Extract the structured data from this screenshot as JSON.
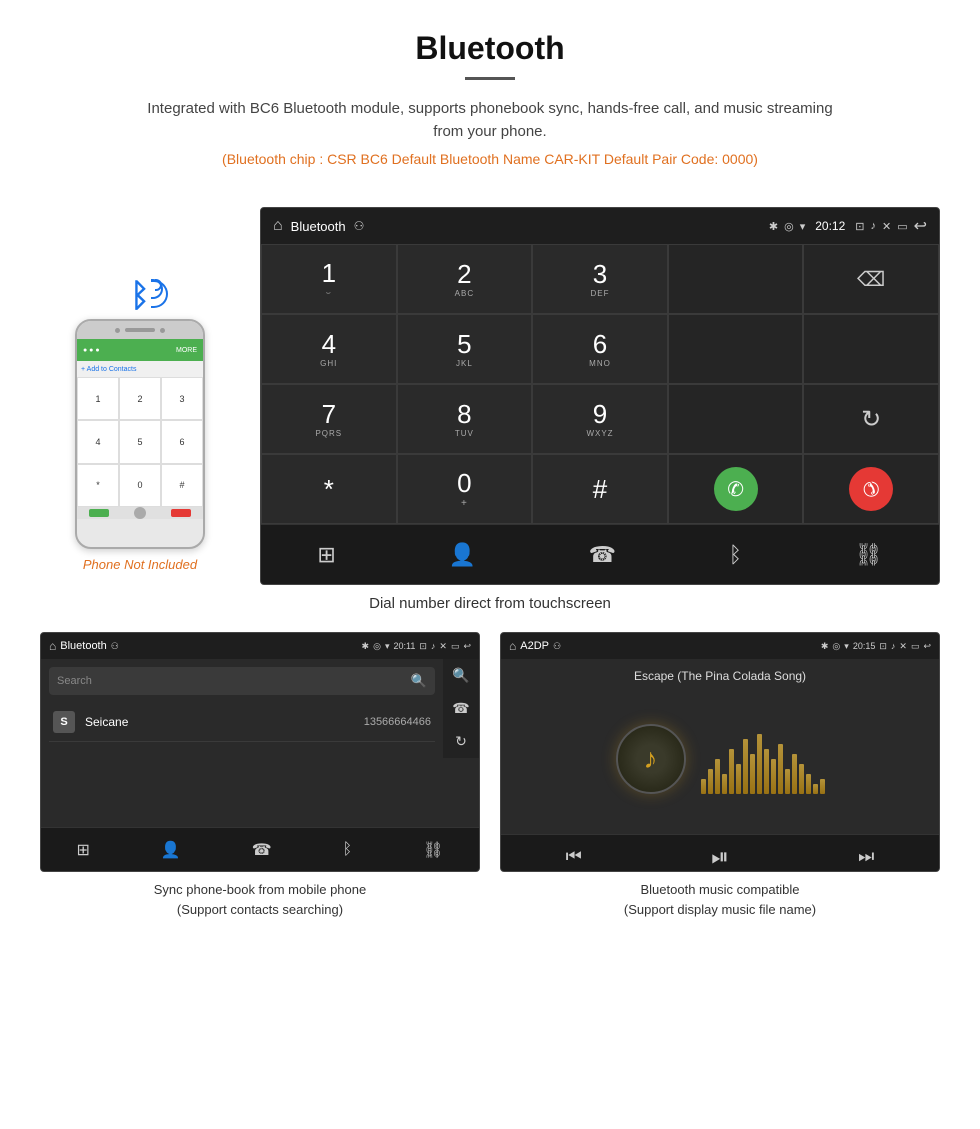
{
  "header": {
    "title": "Bluetooth",
    "description": "Integrated with BC6 Bluetooth module, supports phonebook sync, hands-free call, and music streaming from your phone.",
    "specs": "(Bluetooth chip : CSR BC6    Default Bluetooth Name CAR-KIT    Default Pair Code: 0000)"
  },
  "phone_section": {
    "not_included_label": "Phone Not Included"
  },
  "car_screen": {
    "status_bar": {
      "title": "Bluetooth",
      "time": "20:12"
    },
    "dial_keys": [
      {
        "num": "1",
        "sub": "⌣⌣"
      },
      {
        "num": "2",
        "sub": "ABC"
      },
      {
        "num": "3",
        "sub": "DEF"
      },
      {
        "num": "",
        "sub": "",
        "type": "empty"
      },
      {
        "num": "",
        "sub": "",
        "type": "delete"
      },
      {
        "num": "4",
        "sub": "GHI"
      },
      {
        "num": "5",
        "sub": "JKL"
      },
      {
        "num": "6",
        "sub": "MNO"
      },
      {
        "num": "",
        "sub": "",
        "type": "empty"
      },
      {
        "num": "",
        "sub": "",
        "type": "empty"
      },
      {
        "num": "7",
        "sub": "PQRS"
      },
      {
        "num": "8",
        "sub": "TUV"
      },
      {
        "num": "9",
        "sub": "WXYZ"
      },
      {
        "num": "",
        "sub": "",
        "type": "empty"
      },
      {
        "num": "",
        "sub": "",
        "type": "refresh"
      },
      {
        "num": "*",
        "sub": ""
      },
      {
        "num": "0",
        "sub": "+"
      },
      {
        "num": "#",
        "sub": ""
      },
      {
        "num": "",
        "sub": "",
        "type": "call_green"
      },
      {
        "num": "",
        "sub": "",
        "type": "call_red"
      }
    ],
    "caption": "Dial number direct from touchscreen"
  },
  "phonebook_screen": {
    "status_bar": {
      "title": "Bluetooth",
      "time": "20:11"
    },
    "search_placeholder": "Search",
    "contacts": [
      {
        "initial": "S",
        "name": "Seicane",
        "number": "13566664466"
      }
    ],
    "caption_line1": "Sync phone-book from mobile phone",
    "caption_line2": "(Support contacts searching)"
  },
  "music_screen": {
    "status_bar": {
      "title": "A2DP",
      "time": "20:15"
    },
    "song_title": "Escape (The Pina Colada Song)",
    "caption_line1": "Bluetooth music compatible",
    "caption_line2": "(Support display music file name)"
  },
  "icons": {
    "home": "⌂",
    "bluetooth": "✱",
    "usb": "⚇",
    "bt_sym": "ʙ",
    "location": "◎",
    "wifi": "▾",
    "camera": "⊡",
    "volume": "♪",
    "close_x": "✕",
    "window": "▭",
    "back": "↩",
    "delete": "⌫",
    "refresh": "↻",
    "call": "✆",
    "end_call": "✆",
    "grid": "⊞",
    "person": "👤",
    "phone": "☎",
    "bt_icon": "⚡",
    "link": "⛓",
    "search": "🔍",
    "prev": "⏮",
    "playpause": "⏯",
    "next": "⏭",
    "music_note": "♪"
  },
  "colors": {
    "accent_orange": "#e07020",
    "screen_bg": "#2a2a2a",
    "status_bg": "#1e1e1e",
    "call_green": "#4CAF50",
    "call_red": "#e53935",
    "text_white": "#ffffff",
    "text_gray": "#aaaaaa"
  }
}
